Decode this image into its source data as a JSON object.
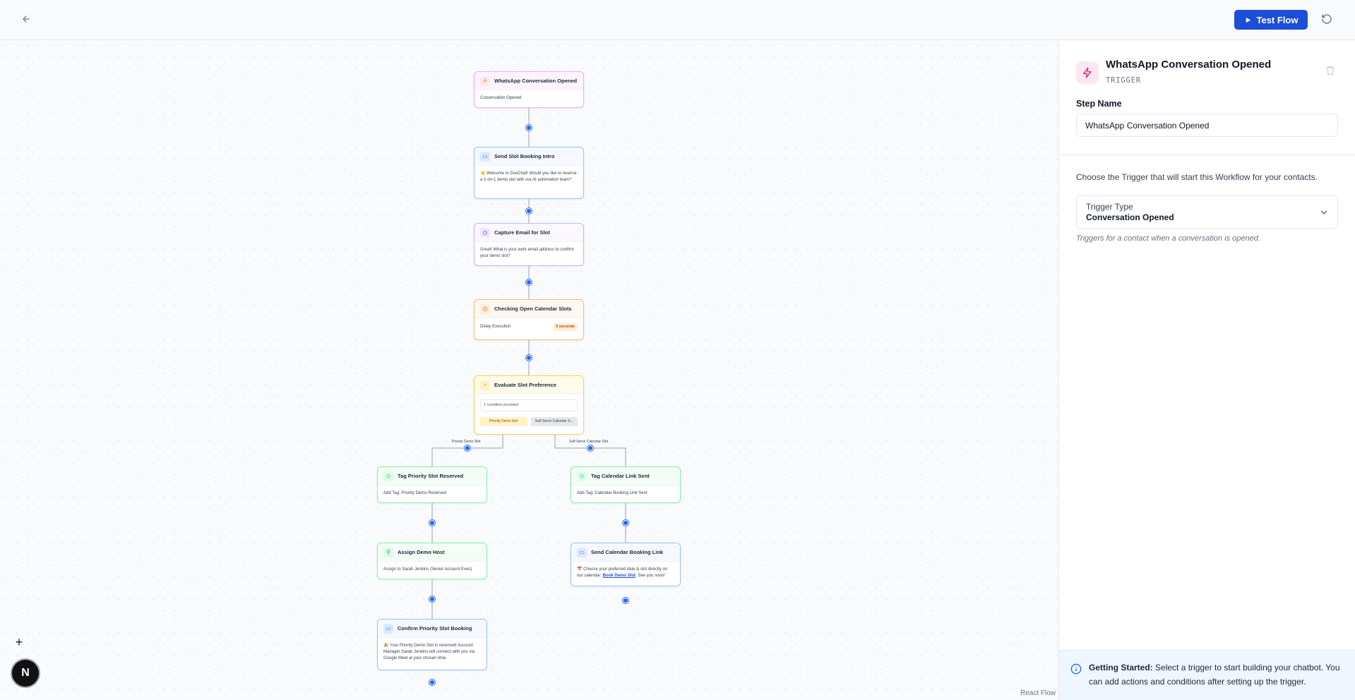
{
  "header": {
    "back_icon": "arrow-left-icon",
    "test_flow_label": "Test Flow",
    "reset_icon": "rotate-ccw-icon",
    "accent_color": "#1d4ed8"
  },
  "nodes": {
    "trigger": {
      "title": "WhatsApp Conversation Opened",
      "body": "Conversation Opened",
      "icon": "zap-icon"
    },
    "intro": {
      "title": "Send Slot Booking Intro",
      "body": "👋 Welcome to DuoChat! Would you like to reserve a 1-on-1 demo slot with our AI automation team?",
      "icon": "message-icon"
    },
    "email": {
      "title": "Capture Email for Slot",
      "body": "Great! What is your work email address to confirm your demo slot?",
      "icon": "clock-icon"
    },
    "delay": {
      "title": "Checking Open Calendar Slots",
      "body": "Delay Execution",
      "badge": "3 seconds",
      "icon": "timer-icon"
    },
    "condition": {
      "title": "Evaluate Slot Preference",
      "conditions": "1 condition provided",
      "branch_a": "Priority Demo Slot",
      "branch_b": "Self-Serve Calendar S...",
      "icon": "branch-icon"
    },
    "tag_priority": {
      "title": "Tag Priority Slot Reserved",
      "body": "Add Tag: Priority Demo Reserved",
      "icon": "tag-icon"
    },
    "tag_calendar": {
      "title": "Tag Calendar Link Sent",
      "body": "Add Tag: Calendar Booking Link Sent",
      "icon": "tag-icon"
    },
    "assign": {
      "title": "Assign Demo Host",
      "body": "Assign to Sarah Jenkins (Senior Account Exec)",
      "icon": "user-assign-icon"
    },
    "send_link": {
      "title": "Send Calendar Booking Link",
      "body_pre": "📅 Choose your preferred date & slot directly on our calendar: ",
      "link_text": "Book Demo Slot",
      "body_post": ". See you soon!",
      "icon": "message-icon"
    },
    "confirm": {
      "title": "Confirm Priority Slot Booking",
      "body": "🎉 Your Priority Demo Slot is reserved! Account Manager Sarah Jenkins will connect with you via Google Meet at your chosen time.",
      "icon": "message-icon"
    }
  },
  "edge_labels": {
    "left": "Priority Demo Slot",
    "right": "Self-Serve Calendar Slot"
  },
  "canvas": {
    "zoom_in_label": "+",
    "avatar_letter": "N",
    "attribution": "React Flow"
  },
  "panel": {
    "title": "WhatsApp Conversation Opened",
    "subtitle": "TRIGGER",
    "icon": "zap-icon",
    "delete_icon": "trash-icon",
    "step_name_label": "Step Name",
    "step_name_value": "WhatsApp Conversation Opened",
    "choose_text": "Choose the Trigger that will start this Workflow for your contacts.",
    "trigger_type_label": "Trigger Type",
    "trigger_type_value": "Conversation Opened",
    "help_text": "Triggers for a contact when a conversation is opened.",
    "getting_started_title": "Getting Started:",
    "getting_started_text": "Select a trigger to start building your chatbot. You can add actions and conditions after setting up the trigger."
  }
}
